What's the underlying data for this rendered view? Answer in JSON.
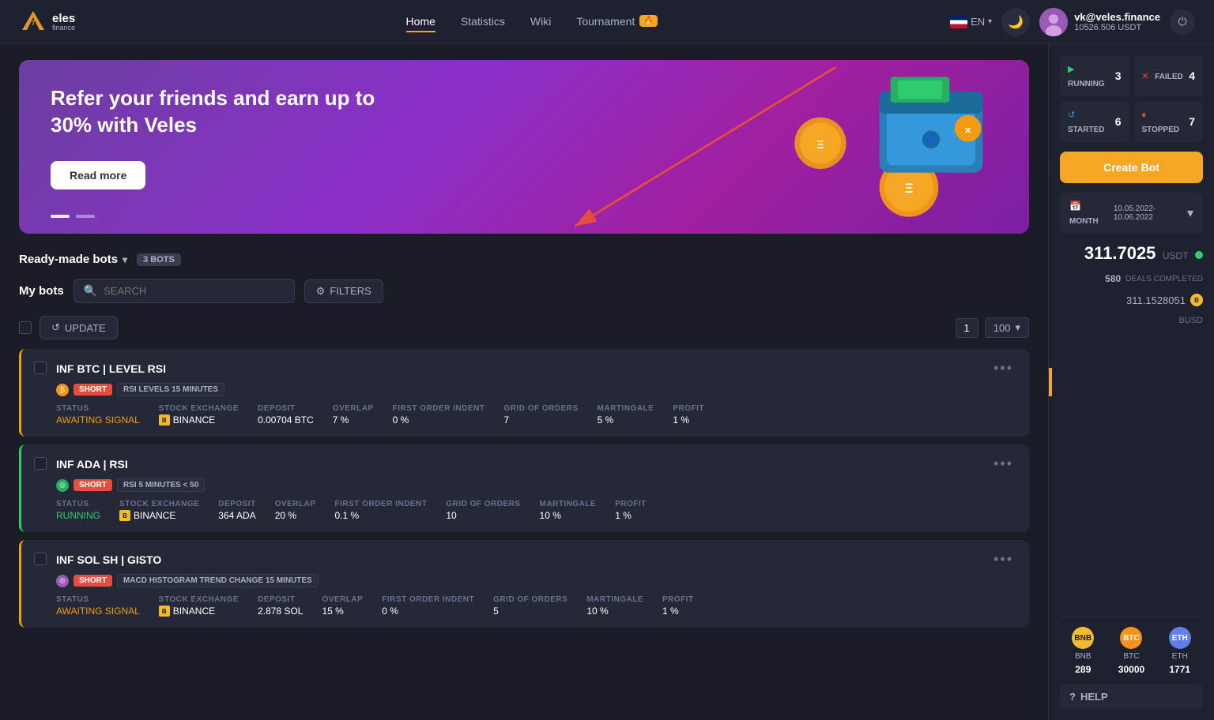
{
  "header": {
    "logo_text": "7eles",
    "nav": {
      "home": "Home",
      "statistics": "Statistics",
      "wiki": "Wiki",
      "tournament": "Tournament",
      "tournament_badge": "🔥"
    },
    "lang": "EN",
    "user": {
      "name": "vk@veles.finance",
      "balance": "10526.506 USDT"
    }
  },
  "banner": {
    "title": "Refer your friends and earn up to 30% with Veles",
    "read_more": "Read more"
  },
  "ready_made_bots": {
    "label": "Ready-made bots",
    "count": "3 BOTS"
  },
  "my_bots": {
    "title": "My bots",
    "search_placeholder": "SEARCH",
    "filters_label": "FILTERS",
    "update_label": "UPDATE",
    "page": "1",
    "page_size": "100"
  },
  "bots": [
    {
      "name": "INF BTC | LEVEL RSI",
      "coin": "₿",
      "tags": [
        "SHORT",
        "RSI LEVELS 15 MINUTES"
      ],
      "status": "AWAITING SIGNAL",
      "status_type": "awaiting",
      "exchange": "BINANCE",
      "deposit": "0.00704 BTC",
      "overlap": "7 %",
      "first_order_indent": "0 %",
      "grid_of_orders": "7",
      "martingale": "5 %",
      "profit": "1 %"
    },
    {
      "name": "INF ADA | RSI",
      "coin": "◎",
      "tags": [
        "SHORT",
        "RSI 5 MINUTES < 50"
      ],
      "status": "RUNNING",
      "status_type": "running",
      "exchange": "BINANCE",
      "deposit": "364 ADA",
      "overlap": "20 %",
      "first_order_indent": "0.1 %",
      "grid_of_orders": "10",
      "martingale": "10 %",
      "profit": "1 %"
    },
    {
      "name": "INF SOL SH | GISTO",
      "coin": "◎",
      "tags": [
        "SHORT",
        "MACD HISTOGRAM TREND CHANGE 15 MINUTES"
      ],
      "status": "AWAITING SIGNAL",
      "status_type": "awaiting",
      "exchange": "BINANCE",
      "deposit": "2.878 SOL",
      "overlap": "15 %",
      "first_order_indent": "0 %",
      "grid_of_orders": "5",
      "martingale": "10 %",
      "profit": "1 %"
    }
  ],
  "sidebar": {
    "status_cards": [
      {
        "label": "RUNNING",
        "count": "3",
        "icon": "▶"
      },
      {
        "label": "FAILED",
        "count": "4",
        "icon": "✕"
      },
      {
        "label": "STARTED",
        "count": "6",
        "icon": "↺"
      },
      {
        "label": "STOPPED",
        "count": "7",
        "icon": "⏸"
      }
    ],
    "create_bot_label": "Create Bot",
    "month_label": "MONTH",
    "month_value": "10.05.2022-10.06.2022",
    "profit_amount": "311.7025",
    "profit_currency": "USDT",
    "deals_count": "580",
    "deals_label": "DEALS COMPLETED",
    "busd_amount": "311.1528051",
    "busd_currency": "BUSD",
    "coins": [
      {
        "symbol": "BNB",
        "value": "289",
        "abbr": "BNB"
      },
      {
        "symbol": "BTC",
        "value": "30000",
        "abbr": "BTC"
      },
      {
        "symbol": "ETH",
        "value": "1771",
        "abbr": "ETH"
      }
    ],
    "help_label": "HELP"
  }
}
